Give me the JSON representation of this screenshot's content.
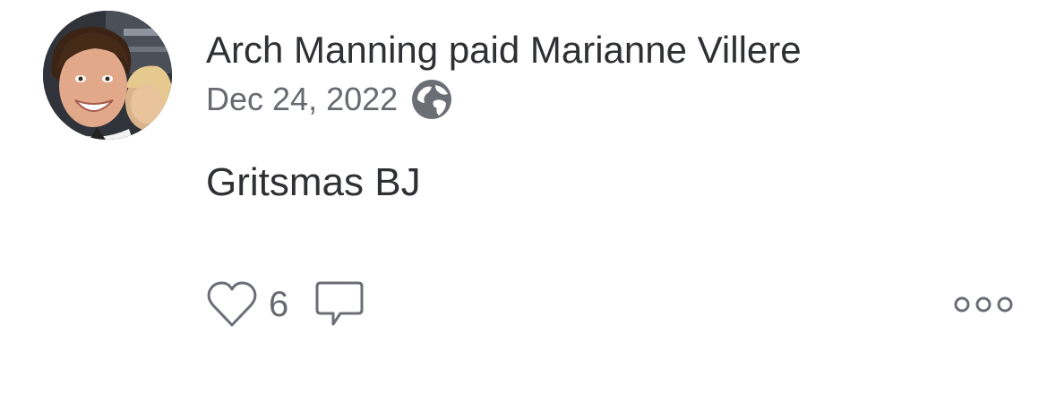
{
  "story": {
    "actor_name": "Arch Manning",
    "verb": "paid",
    "target_name": "Marianne Villere",
    "date": "Dec 24, 2022",
    "privacy_icon": "globe-icon",
    "note": "Gritsmas BJ",
    "like_icon": "heart-outline-icon",
    "like_count": "6",
    "comment_icon": "speech-bubble-icon",
    "more_icon": "ellipsis-icon"
  },
  "colors": {
    "text_primary": "#2f3033",
    "text_secondary": "#676a70",
    "icon_gray": "#6b6e75"
  }
}
